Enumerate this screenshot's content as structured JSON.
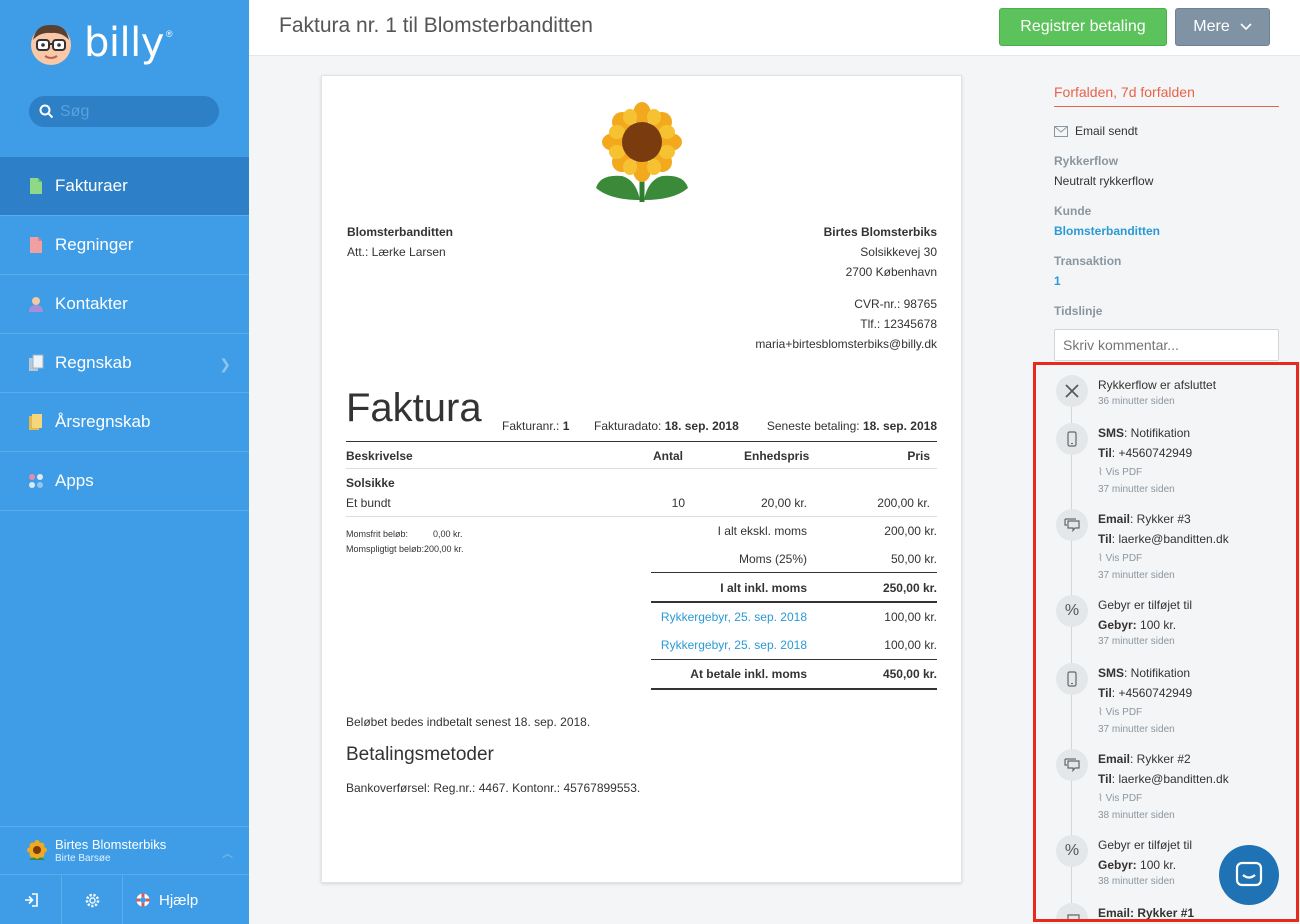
{
  "brand": {
    "name": "billy",
    "reg": "®"
  },
  "search": {
    "placeholder": "Søg"
  },
  "nav": [
    {
      "label": "Fakturaer",
      "icon": "invoice-icon",
      "color": "#8fd88a"
    },
    {
      "label": "Regninger",
      "icon": "bill-icon",
      "color": "#f0a0a0"
    },
    {
      "label": "Kontakter",
      "icon": "contact-icon",
      "color": "#a58fd8"
    },
    {
      "label": "Regnskab",
      "icon": "accounting-icon",
      "color": "#dfe9f3"
    },
    {
      "label": "Årsregnskab",
      "icon": "annual-report-icon",
      "color": "#f4d77a"
    },
    {
      "label": "Apps",
      "icon": "apps-icon",
      "color": "#dfe9f3"
    }
  ],
  "company": {
    "name": "Birtes Blomsterbiks",
    "user": "Birte Barsøe"
  },
  "bottom": {
    "help": "Hjælp"
  },
  "header": {
    "title": "Faktura nr. 1 til Blomsterbanditten",
    "register_payment": "Registrer betaling",
    "more": "Mere"
  },
  "invoice": {
    "customer": {
      "name": "Blomsterbanditten",
      "att": "Att.: Lærke Larsen"
    },
    "seller": {
      "name": "Birtes Blomsterbiks",
      "street": "Solsikkevej 30",
      "city": "2700 København",
      "cvr": "CVR-nr.: 98765",
      "phone": "Tlf.: 12345678",
      "email": "maria+birtesblomsterbiks@billy.dk"
    },
    "title": "Faktura",
    "number_label": "Fakturanr.:",
    "number": "1",
    "date_label": "Fakturadato:",
    "date": "18. sep. 2018",
    "due_label": "Seneste betaling:",
    "due": "18. sep. 2018",
    "columns": {
      "desc": "Beskrivelse",
      "qty": "Antal",
      "unit": "Enhedspris",
      "price": "Pris"
    },
    "item": {
      "name": "Solsikke",
      "desc": "Et bundt",
      "qty": "10",
      "unit": "20,00 kr.",
      "price": "200,00 kr."
    },
    "momsfri_label": "Momsfrit beløb:",
    "momsfri": "0,00 kr.",
    "momspligt_label": "Momspligtigt beløb:",
    "momspligt": "200,00 kr.",
    "totals": {
      "excl_label": "I alt ekskl. moms",
      "excl": "200,00 kr.",
      "vat_label": "Moms (25%)",
      "vat": "50,00 kr.",
      "incl_label": "I alt inkl. moms",
      "incl": "250,00 kr.",
      "fee1_label": "Rykkergebyr, 25. sep. 2018",
      "fee1": "100,00 kr.",
      "fee2_label": "Rykkergebyr, 25. sep. 2018",
      "fee2": "100,00 kr.",
      "due_label": "At betale inkl. moms",
      "due": "450,00 kr."
    },
    "payment_note": "Beløbet bedes indbetalt senest 18. sep. 2018.",
    "payment_methods_title": "Betalingsmetoder",
    "payment_methods": "Bankoverførsel: Reg.nr.: 4467. Kontonr.: 45767899553."
  },
  "panel": {
    "status": "Forfalden, 7d forfalden",
    "email_sent": "Email sendt",
    "flow_label": "Rykkerflow",
    "flow_value": "Neutralt rykkerflow",
    "customer_label": "Kunde",
    "customer_value": "Blomsterbanditten",
    "transaction_label": "Transaktion",
    "transaction_value": "1",
    "timeline_label": "Tidslinje",
    "comment_placeholder": "Skriv kommentar..."
  },
  "timeline": [
    {
      "icon": "close-icon",
      "title": "Rykkerflow er afsluttet",
      "time": "36 minutter siden"
    },
    {
      "icon": "phone-icon",
      "bold1": "SMS",
      "text1": ": Notifikation",
      "bold2": "Til",
      "text2": ": +4560742949",
      "pdf": "Vis PDF",
      "time": "37 minutter siden"
    },
    {
      "icon": "message-icon",
      "bold1": "Email",
      "text1": ": Rykker #3",
      "bold2": "Til",
      "text2": ": laerke@banditten.dk",
      "pdf": "Vis PDF",
      "time": "37 minutter siden"
    },
    {
      "icon": "percent-icon",
      "text1": "Gebyr er tilføjet til",
      "bold2": "Gebyr:",
      "text2": " 100 kr.",
      "time": "37 minutter siden"
    },
    {
      "icon": "phone-icon",
      "bold1": "SMS",
      "text1": ": Notifikation",
      "bold2": "Til",
      "text2": ": +4560742949",
      "pdf": "Vis PDF",
      "time": "37 minutter siden"
    },
    {
      "icon": "message-icon",
      "bold1": "Email",
      "text1": ": Rykker #2",
      "bold2": "Til",
      "text2": ": laerke@banditten.dk",
      "pdf": "Vis PDF",
      "time": "38 minutter siden"
    },
    {
      "icon": "percent-icon",
      "text1": "Gebyr er tilføjet til",
      "bold2": "Gebyr:",
      "text2": " 100 kr.",
      "time": "38 minutter siden"
    },
    {
      "icon": "message-icon",
      "bold1": "Email",
      "text1": ": Rykker #1"
    }
  ]
}
